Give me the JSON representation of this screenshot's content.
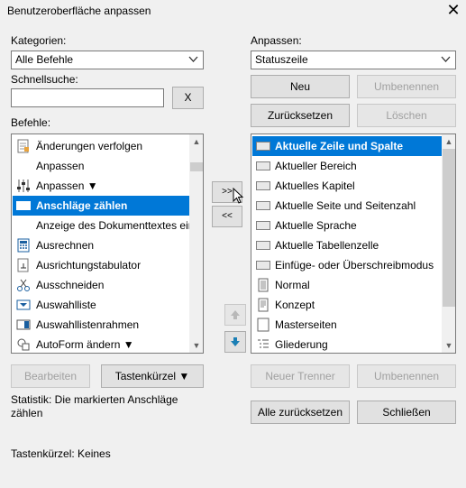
{
  "window": {
    "title": "Benutzeroberfläche anpassen",
    "close_glyph": "✕"
  },
  "left": {
    "categories_label": "Kategorien:",
    "categories_value": "Alle Befehle",
    "quicksearch_label": "Schnellsuche:",
    "quicksearch_value": "",
    "clear_button": "X",
    "commands_label": "Befehle:",
    "commands": [
      {
        "label": "Änderungen verfolgen",
        "icon": "track-changes-icon"
      },
      {
        "label": "Anpassen",
        "icon": ""
      },
      {
        "label": "Anpassen ▼",
        "icon": "sliders-icon"
      },
      {
        "label": "Anschläge zählen",
        "icon": "rectangle-icon",
        "selected": true
      },
      {
        "label": "Anzeige des Dokumenttextes ein",
        "icon": ""
      },
      {
        "label": "Ausrechnen",
        "icon": "calculator-icon"
      },
      {
        "label": "Ausrichtungstabulator",
        "icon": "tab-stop-icon"
      },
      {
        "label": "Ausschneiden",
        "icon": "scissors-icon"
      },
      {
        "label": "Auswahlliste",
        "icon": "dropdown-list-icon"
      },
      {
        "label": "Auswahllistenrahmen",
        "icon": "dropdown-frame-icon"
      },
      {
        "label": "AutoForm ändern ▼",
        "icon": "shape-icon"
      }
    ],
    "edit_button": "Bearbeiten",
    "shortcut_button": "Tastenkürzel ▼",
    "statistic": "Statistik: Die markierten Anschläge zählen",
    "shortcut_info": "Tastenkürzel: Keines"
  },
  "middle": {
    "add_button": ">>",
    "remove_button": "<<"
  },
  "right": {
    "customize_label": "Anpassen:",
    "customize_value": "Statuszeile",
    "new_button": "Neu",
    "rename_button": "Umbenennen",
    "reset_button": "Zurücksetzen",
    "delete_button": "Löschen",
    "items": [
      {
        "label": "Aktuelle Zeile und Spalte",
        "icon": "rectangle-icon",
        "selected": true
      },
      {
        "label": "Aktueller Bereich",
        "icon": "rectangle-icon"
      },
      {
        "label": "Aktuelles Kapitel",
        "icon": "rectangle-icon"
      },
      {
        "label": "Aktuelle Seite und Seitenzahl",
        "icon": "rectangle-icon"
      },
      {
        "label": "Aktuelle Sprache",
        "icon": "rectangle-icon"
      },
      {
        "label": "Aktuelle Tabellenzelle",
        "icon": "rectangle-icon"
      },
      {
        "label": "Einfüge- oder Überschreibmodus",
        "icon": "rectangle-icon"
      },
      {
        "label": "Normal",
        "icon": "page-icon"
      },
      {
        "label": "Konzept",
        "icon": "page-icon"
      },
      {
        "label": "Masterseiten",
        "icon": "page-icon"
      },
      {
        "label": "Gliederung",
        "icon": "outline-icon"
      }
    ],
    "new_separator_button": "Neuer Trenner",
    "rename2_button": "Umbenennen",
    "reset_all_button": "Alle zurücksetzen",
    "close_button": "Schließen"
  },
  "colors": {
    "selection": "#0078d7",
    "move_arrow": "#1a7fb5"
  }
}
